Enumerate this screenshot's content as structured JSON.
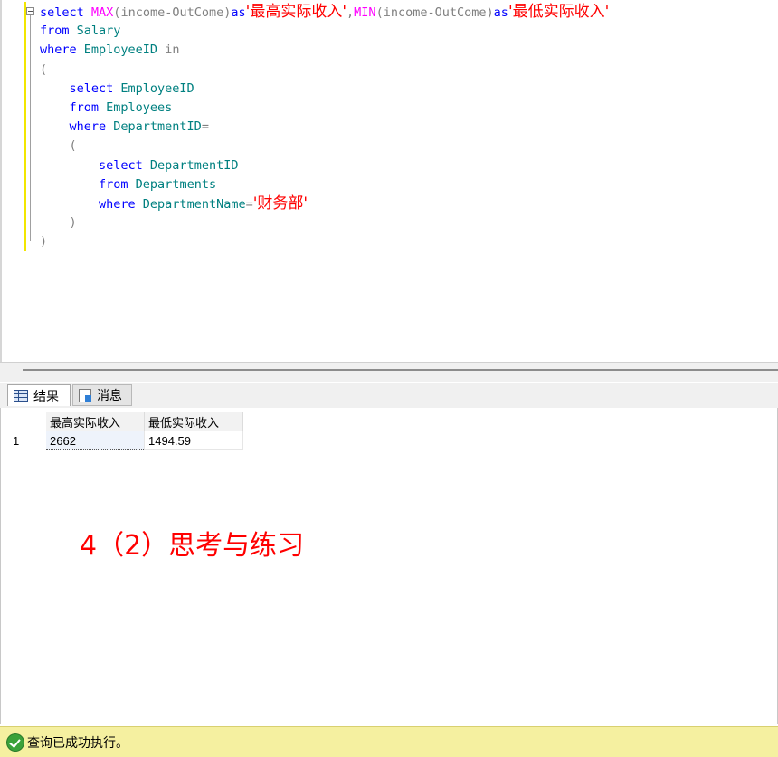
{
  "editor": {
    "lines": [
      [
        {
          "t": "select ",
          "c": "kw"
        },
        {
          "t": "MAX",
          "c": "fn"
        },
        {
          "t": "(",
          "c": "gr"
        },
        {
          "t": "income",
          "c": "gr"
        },
        {
          "t": "-",
          "c": "gr"
        },
        {
          "t": "OutCome",
          "c": "gr"
        },
        {
          "t": ")",
          "c": "gr"
        },
        {
          "t": "as",
          "c": "kw"
        },
        {
          "t": "'最高实际收入'",
          "c": "str"
        },
        {
          "t": ",",
          "c": "gr"
        },
        {
          "t": "MIN",
          "c": "fn"
        },
        {
          "t": "(",
          "c": "gr"
        },
        {
          "t": "income",
          "c": "gr"
        },
        {
          "t": "-",
          "c": "gr"
        },
        {
          "t": "OutCome",
          "c": "gr"
        },
        {
          "t": ")",
          "c": "gr"
        },
        {
          "t": "as",
          "c": "kw"
        },
        {
          "t": "'最低实际收入'",
          "c": "str"
        }
      ],
      [
        {
          "t": "from ",
          "c": "kw"
        },
        {
          "t": "Salary",
          "c": "id"
        }
      ],
      [
        {
          "t": "where ",
          "c": "kw"
        },
        {
          "t": "EmployeeID ",
          "c": "id"
        },
        {
          "t": "in",
          "c": "gr"
        }
      ],
      [
        {
          "t": "(",
          "c": "gr"
        }
      ],
      [
        {
          "t": "    select ",
          "c": "kw"
        },
        {
          "t": "EmployeeID",
          "c": "id"
        }
      ],
      [
        {
          "t": "    from ",
          "c": "kw"
        },
        {
          "t": "Employees",
          "c": "id"
        }
      ],
      [
        {
          "t": "    where ",
          "c": "kw"
        },
        {
          "t": "DepartmentID",
          "c": "id"
        },
        {
          "t": "=",
          "c": "gr"
        }
      ],
      [
        {
          "t": "    (",
          "c": "gr"
        }
      ],
      [
        {
          "t": "        select ",
          "c": "kw"
        },
        {
          "t": "DepartmentID",
          "c": "id"
        }
      ],
      [
        {
          "t": "        from ",
          "c": "kw"
        },
        {
          "t": "Departments",
          "c": "id"
        }
      ],
      [
        {
          "t": "        where ",
          "c": "kw"
        },
        {
          "t": "DepartmentName",
          "c": "id"
        },
        {
          "t": "=",
          "c": "gr"
        },
        {
          "t": "'财务部'",
          "c": "str"
        }
      ],
      [
        {
          "t": "    )",
          "c": "gr"
        }
      ],
      [
        {
          "t": ")",
          "c": "gr"
        }
      ]
    ]
  },
  "tabs": {
    "results_label": "结果",
    "messages_label": "消息"
  },
  "results": {
    "columns": [
      "最高实际收入",
      "最低实际收入"
    ],
    "rows": [
      {
        "num": "1",
        "values": [
          "2662",
          "1494.59"
        ]
      }
    ]
  },
  "annotation": "4（2）思考与练习",
  "status": {
    "message": "查询已成功执行。"
  },
  "colors": {
    "keyword": "#0000ff",
    "function": "#ff00ff",
    "operator": "#808080",
    "identifier": "#008080",
    "string": "#ff0000",
    "status_bg": "#f5f0a0"
  }
}
